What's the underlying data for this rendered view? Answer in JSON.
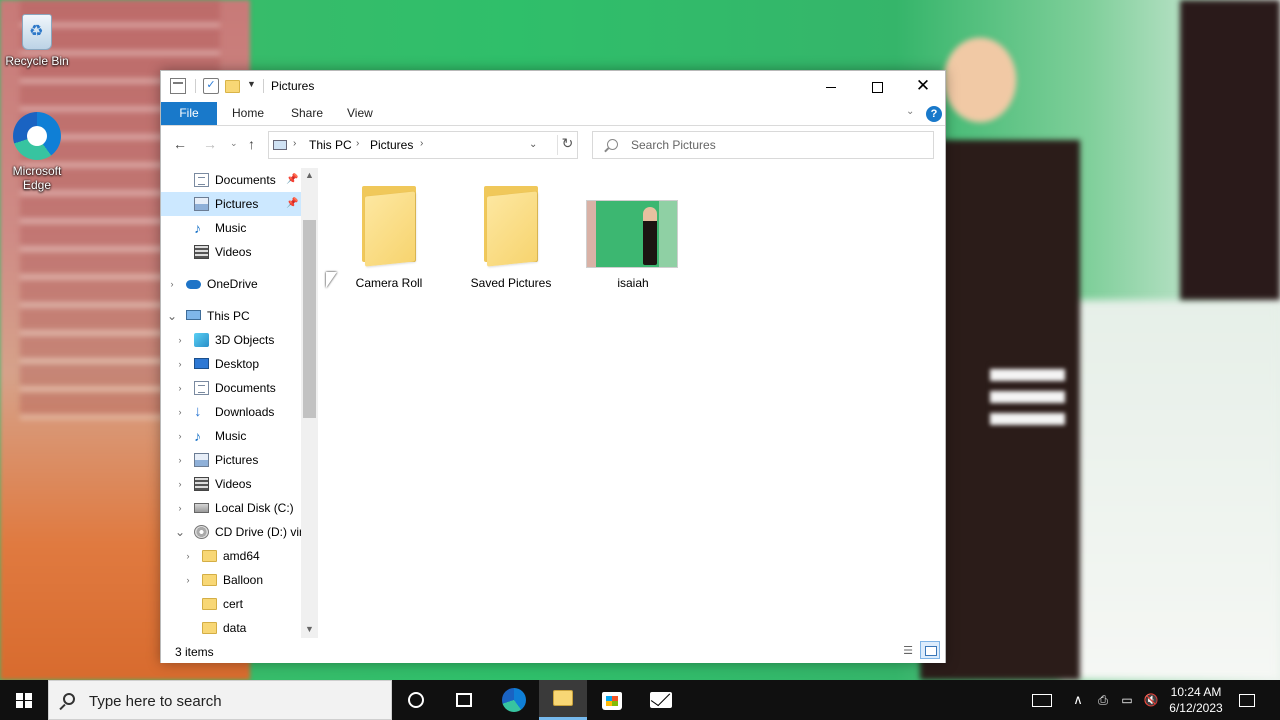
{
  "desktop": {
    "icons": [
      {
        "label": "Recycle Bin",
        "icon": "recycle-bin-icon"
      },
      {
        "label": "Microsoft Edge",
        "icon": "edge-icon"
      }
    ]
  },
  "window": {
    "title": "Pictures",
    "controls": {
      "minimize": "minimize",
      "maximize": "maximize",
      "close": "✕"
    }
  },
  "ribbon": {
    "tabs": [
      "File",
      "Home",
      "Share",
      "View"
    ],
    "help": "?"
  },
  "address": {
    "breadcrumbs": [
      "This PC",
      "Pictures"
    ],
    "separator": "›",
    "refresh": "↻"
  },
  "search": {
    "placeholder": "Search Pictures"
  },
  "nav": {
    "back": "←",
    "forward": "→",
    "recent": "⌄",
    "up": "↑"
  },
  "navpane": {
    "items": [
      {
        "label": "Documents",
        "icon": "documents-icon",
        "pinned": true
      },
      {
        "label": "Pictures",
        "icon": "pictures-icon",
        "pinned": true,
        "selected": true
      },
      {
        "label": "Music",
        "icon": "music-icon"
      },
      {
        "label": "Videos",
        "icon": "videos-icon"
      },
      {
        "label": "OneDrive",
        "icon": "onedrive-icon",
        "expandable": true
      },
      {
        "label": "This PC",
        "icon": "this-pc-icon",
        "expanded": true
      },
      {
        "label": "3D Objects",
        "icon": "3d-objects-icon",
        "expandable": true
      },
      {
        "label": "Desktop",
        "icon": "desktop-icon",
        "expandable": true
      },
      {
        "label": "Documents",
        "icon": "documents-icon",
        "expandable": true
      },
      {
        "label": "Downloads",
        "icon": "downloads-icon",
        "expandable": true
      },
      {
        "label": "Music",
        "icon": "music-icon",
        "expandable": true
      },
      {
        "label": "Pictures",
        "icon": "pictures-icon",
        "expandable": true
      },
      {
        "label": "Videos",
        "icon": "videos-icon",
        "expandable": true
      },
      {
        "label": "Local Disk (C:)",
        "icon": "local-disk-icon",
        "expandable": true
      },
      {
        "label": "CD Drive (D:) virt",
        "icon": "cd-drive-icon",
        "expanded": true
      },
      {
        "label": "amd64",
        "icon": "folder-icon",
        "expandable": true
      },
      {
        "label": "Balloon",
        "icon": "folder-icon",
        "expandable": true
      },
      {
        "label": "cert",
        "icon": "folder-icon"
      },
      {
        "label": "data",
        "icon": "folder-icon"
      }
    ],
    "pin_glyph": "📌",
    "collapsed_glyph": "›",
    "expanded_glyph": "⌄"
  },
  "content": {
    "items": [
      {
        "name": "Camera Roll",
        "type": "folder"
      },
      {
        "name": "Saved Pictures",
        "type": "folder"
      },
      {
        "name": "isaiah",
        "type": "image"
      }
    ]
  },
  "status": {
    "item_count": "3 items"
  },
  "taskbar": {
    "search_placeholder": "Type here to search",
    "clock_time": "10:24 AM",
    "clock_date": "6/12/2023",
    "tray_chevron": "∧",
    "tray_device": "⎙",
    "tray_network": "▭",
    "tray_volume": "🔇"
  }
}
